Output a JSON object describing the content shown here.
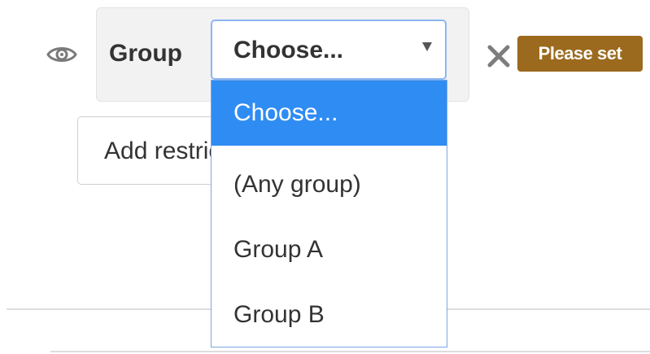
{
  "restriction": {
    "label": "Group",
    "select": {
      "value": "Choose...",
      "options": [
        "Choose...",
        "(Any group)",
        "Group A",
        "Group B"
      ],
      "selected_index": 0
    },
    "status_badge": "Please set",
    "eye_icon": "eye-icon",
    "delete_icon": "close-icon"
  },
  "add_restriction_button": {
    "label": "Add restriction..."
  },
  "colors": {
    "badge_bg": "#9b6a1e",
    "option_highlight": "#2f8cf3",
    "select_border": "#8ab6f2"
  }
}
